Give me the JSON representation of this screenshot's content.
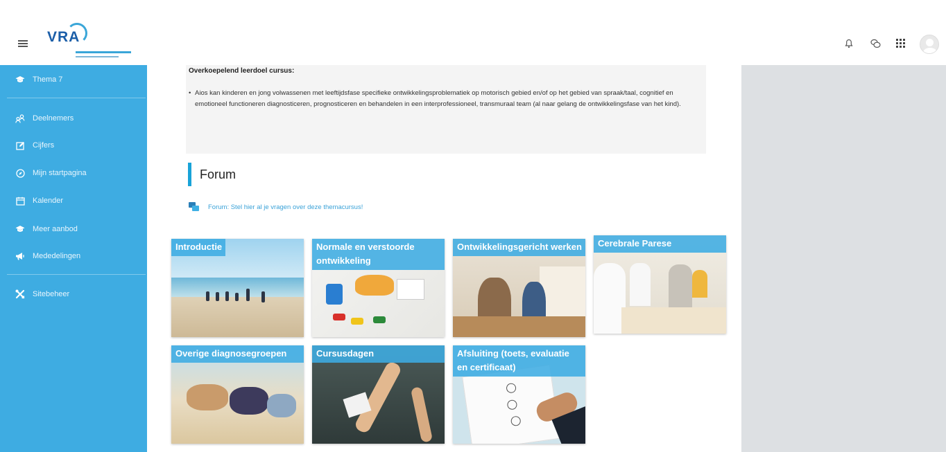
{
  "header": {
    "logo_text": "VRA",
    "icons": [
      "menu-icon",
      "bell-icon",
      "chat-icon",
      "apps-grid-icon",
      "user-avatar"
    ]
  },
  "sidebar": {
    "items": [
      {
        "label": "Thema 7",
        "icon": "graduation-cap-icon"
      },
      {
        "label": "Deelnemers",
        "icon": "users-icon"
      },
      {
        "label": "Cijfers",
        "icon": "pencil-square-icon"
      },
      {
        "label": "Mijn startpagina",
        "icon": "compass-icon"
      },
      {
        "label": "Kalender",
        "icon": "calendar-icon"
      },
      {
        "label": "Meer aanbod",
        "icon": "graduation-cap-icon"
      },
      {
        "label": "Mededelingen",
        "icon": "megaphone-icon"
      },
      {
        "label": "Sitebeheer",
        "icon": "tools-icon"
      }
    ]
  },
  "main": {
    "goal": {
      "title": "Overkoepelend leerdoel cursus:",
      "bullet": "Aios kan kinderen en jong volwassenen met leeftijdsfase specifieke ontwikkelingsproblematiek op motorisch gebied en/of op het gebied van spraak/taal, cognitief en emotioneel functioneren diagnosticeren, prognosticeren en behandelen in een interprofessioneel, transmuraal team (al naar gelang de ontwikkelingsfase van het kind)."
    },
    "section_title": "Forum",
    "forum_link": "Forum: Stel hier al je vragen over deze themacursus!",
    "tiles": [
      {
        "label": "Introductie"
      },
      {
        "label": "Normale en verstoorde ontwikkeling"
      },
      {
        "label": "Ontwikkelingsgericht werken"
      },
      {
        "label": "Cerebrale Parese"
      },
      {
        "label": "Overige diagnosegroepen"
      },
      {
        "label": "Cursusdagen"
      },
      {
        "label": "Afsluiting (toets, evaluatie en certificaat)"
      }
    ]
  },
  "colors": {
    "sidebar": "#3eace2",
    "accent": "#19a3d8",
    "right_panel": "#dde0e3",
    "tile_label_bg": "#3eace2"
  }
}
